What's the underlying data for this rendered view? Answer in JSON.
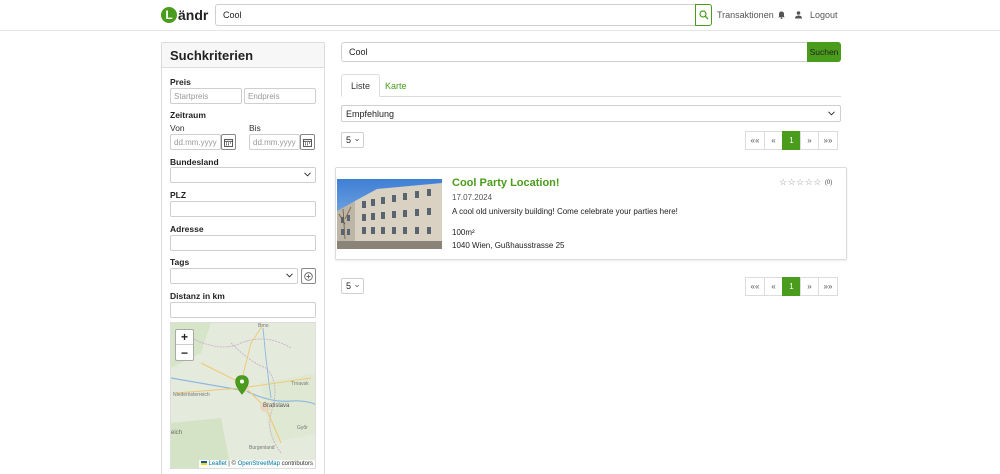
{
  "header": {
    "logo_letter": "L",
    "logo_text": "ändr",
    "search_value": "Cool",
    "nav": {
      "transactions": "Transaktionen",
      "logout": "Logout"
    }
  },
  "sidebar": {
    "title": "Suchkriterien",
    "price": {
      "label": "Preis",
      "start_placeholder": "Startpreis",
      "end_placeholder": "Endpreis"
    },
    "period": {
      "label": "Zeitraum",
      "from_label": "Von",
      "to_label": "Bis",
      "date_placeholder": "dd.mm.yyyy"
    },
    "state_label": "Bundesland",
    "zip_label": "PLZ",
    "address_label": "Adresse",
    "tags_label": "Tags",
    "distance_label": "Distanz in km",
    "map": {
      "zoom_in": "+",
      "zoom_out": "−",
      "attribution": {
        "leaflet": "Leaflet",
        "separator": "| ©",
        "osm": "OpenStreetMap",
        "suffix": "contributors"
      },
      "place_labels": [
        "Brno",
        "Niederösterreich",
        "Bratislava",
        "Trnavsk",
        "Győr",
        "Burgenland",
        "eich"
      ]
    }
  },
  "main": {
    "search_value": "Cool",
    "search_button": "Suchen",
    "tabs": [
      "Liste",
      "Karte"
    ],
    "sort_value": "Empfehlung",
    "per_page": "5",
    "pagination": {
      "first": "««",
      "prev": "«",
      "current": "1",
      "next": "»",
      "last": "»»"
    },
    "listing": {
      "title": "Cool Party Location!",
      "date": "17.07.2024",
      "description": "A cool old university building! Come celebrate your parties here!",
      "size": "100m²",
      "address": "1040 Wien, Gußhausstrasse 25",
      "rating_count": "(0)"
    }
  },
  "colors": {
    "brand_green": "#4a9c1c"
  }
}
